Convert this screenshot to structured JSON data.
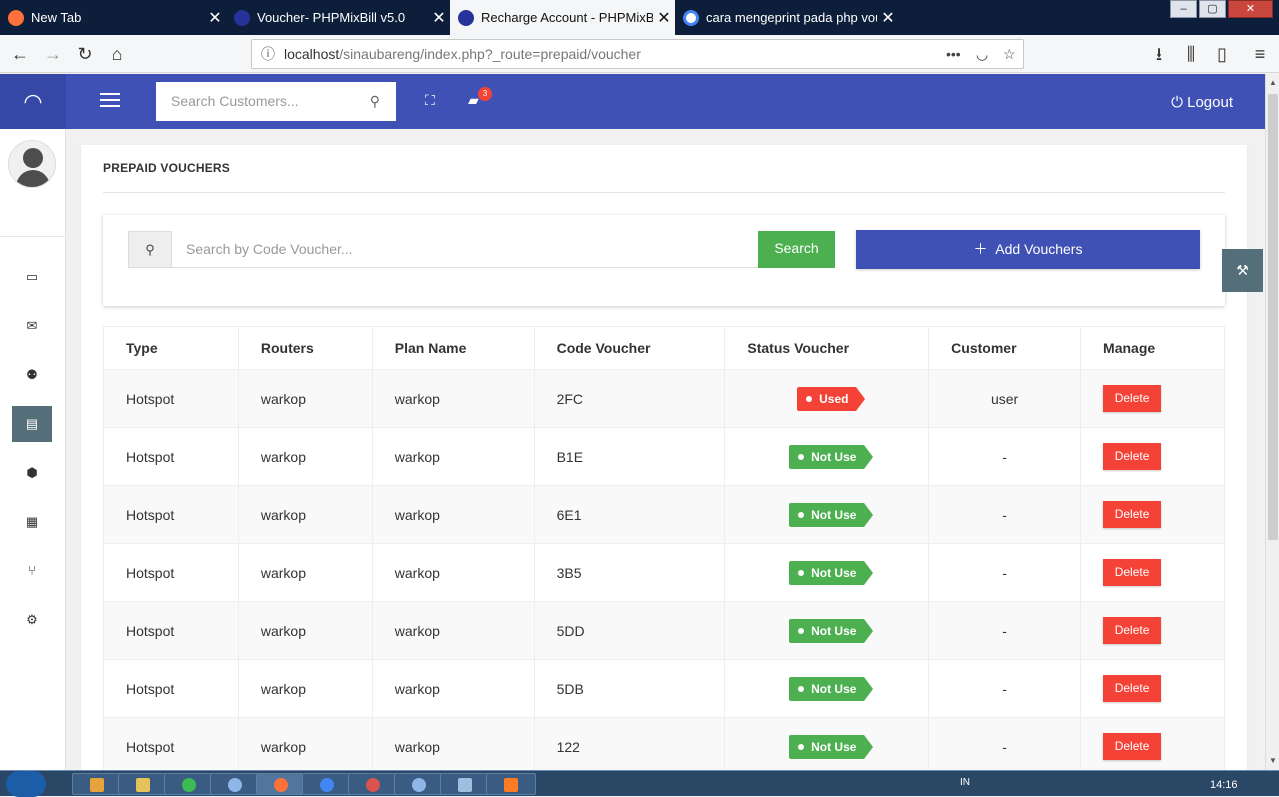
{
  "browser": {
    "tabs": [
      {
        "label": "New Tab",
        "icon": "firefox-icon"
      },
      {
        "label": "Voucher- PHPMixBill v5.0",
        "icon": "phpmixbill-icon"
      },
      {
        "label": "Recharge Account - PHPMixBil",
        "icon": "phpmixbill-icon"
      },
      {
        "label": "cara mengeprint pada php vou",
        "icon": "google-icon"
      }
    ],
    "url_host": "localhost",
    "url_path": "/sinaubareng/index.php?_route=prepaid/voucher",
    "window_buttons": [
      "–",
      "▢",
      "✕"
    ]
  },
  "header": {
    "search_placeholder": "Search Customers...",
    "notifications_count": "3",
    "logout_label": "Logout"
  },
  "sidebar": {
    "items": [
      "dashboard-icon",
      "mail-icon",
      "customers-icon",
      "prepaid-icon",
      "package-icon",
      "reports-icon",
      "network-icon",
      "settings-icon"
    ],
    "active": "prepaid-icon"
  },
  "main": {
    "title": "PREPAID VOUCHERS",
    "search_placeholder": "Search by Code Voucher...",
    "search_button": "Search",
    "add_button": "Add Vouchers"
  },
  "table": {
    "headers": [
      "Type",
      "Routers",
      "Plan Name",
      "Code Voucher",
      "Status Voucher",
      "Customer",
      "Manage"
    ],
    "rows": [
      {
        "type": "Hotspot",
        "router": "warkop",
        "plan": "warkop",
        "code": "2FC",
        "status": "Used",
        "customer": "user",
        "action": "Delete"
      },
      {
        "type": "Hotspot",
        "router": "warkop",
        "plan": "warkop",
        "code": "B1E",
        "status": "Not Use",
        "customer": "-",
        "action": "Delete"
      },
      {
        "type": "Hotspot",
        "router": "warkop",
        "plan": "warkop",
        "code": "6E1",
        "status": "Not Use",
        "customer": "-",
        "action": "Delete"
      },
      {
        "type": "Hotspot",
        "router": "warkop",
        "plan": "warkop",
        "code": "3B5",
        "status": "Not Use",
        "customer": "-",
        "action": "Delete"
      },
      {
        "type": "Hotspot",
        "router": "warkop",
        "plan": "warkop",
        "code": "5DD",
        "status": "Not Use",
        "customer": "-",
        "action": "Delete"
      },
      {
        "type": "Hotspot",
        "router": "warkop",
        "plan": "warkop",
        "code": "5DB",
        "status": "Not Use",
        "customer": "-",
        "action": "Delete"
      },
      {
        "type": "Hotspot",
        "router": "warkop",
        "plan": "warkop",
        "code": "122",
        "status": "Not Use",
        "customer": "-",
        "action": "Delete"
      }
    ]
  },
  "taskbar": {
    "lang": "IN",
    "time": "14:16"
  },
  "colors": {
    "primary": "#3f51b5",
    "success": "#4caf50",
    "danger": "#f44336",
    "sidebar_active": "#546e7a"
  }
}
